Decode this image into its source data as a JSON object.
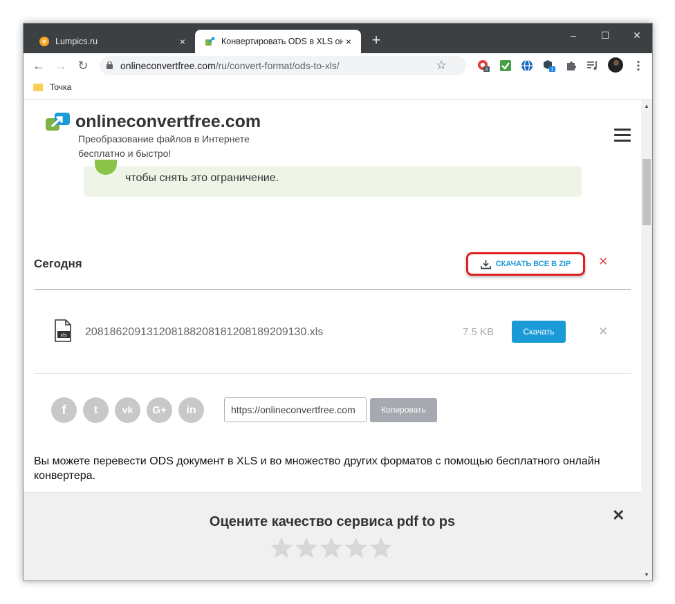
{
  "browser": {
    "tabs": [
      {
        "title": "Lumpics.ru",
        "close": "×"
      },
      {
        "title": "Конвертировать ODS в XLS онл",
        "close": "×"
      }
    ],
    "new_tab": "+",
    "window_controls": {
      "minimize": "–",
      "maximize": "☐",
      "close": "✕"
    },
    "nav": {
      "back": "←",
      "forward": "→",
      "reload": "↻"
    },
    "url_host": "onlineconvertfree.com",
    "url_path": "/ru/convert-format/ods-to-xls/",
    "bookmark_star": "☆",
    "extensions": [
      {
        "icon": "opera-red-icon",
        "badge": "4"
      },
      {
        "icon": "green-check-icon"
      },
      {
        "icon": "globe-icon"
      },
      {
        "icon": "box-icon",
        "badge": "1"
      },
      {
        "icon": "puzzle-icon"
      },
      {
        "icon": "media-control-icon"
      },
      {
        "icon": "avatar"
      },
      {
        "icon": "more-icon"
      }
    ],
    "bookmarks": [
      {
        "label": "Точка"
      }
    ]
  },
  "site": {
    "brand": "onlineconvertfree.com",
    "tagline": "Преобразование файлов в Интернете бесплатно и быстро!",
    "notice_text": "чтобы снять это ограничение.",
    "section_title": "Сегодня",
    "zip_button": "СКАЧАТЬ ВСЕ В ZIP",
    "file": {
      "name": "208186209131208188208181208189209130.xls",
      "size": "7.5 KB",
      "download": "Скачать",
      "icon_label": "xls"
    },
    "share": {
      "social": [
        "f",
        "t",
        "vk",
        "G+",
        "in"
      ],
      "link_value": "https://onlineconvertfree.com",
      "copy": "Копировать"
    },
    "description": "Вы можете перевести ODS документ в XLS и во множество других форматов с помощью бесплатного онлайн конвертера.",
    "rating": {
      "title": "Оцените качество сервиса pdf to ps",
      "stars_total": 5,
      "stars_selected": 0
    }
  },
  "colors": {
    "accent": "#1a9ad6",
    "highlight_border": "#e02020",
    "notice_bg": "#eef4e6"
  }
}
